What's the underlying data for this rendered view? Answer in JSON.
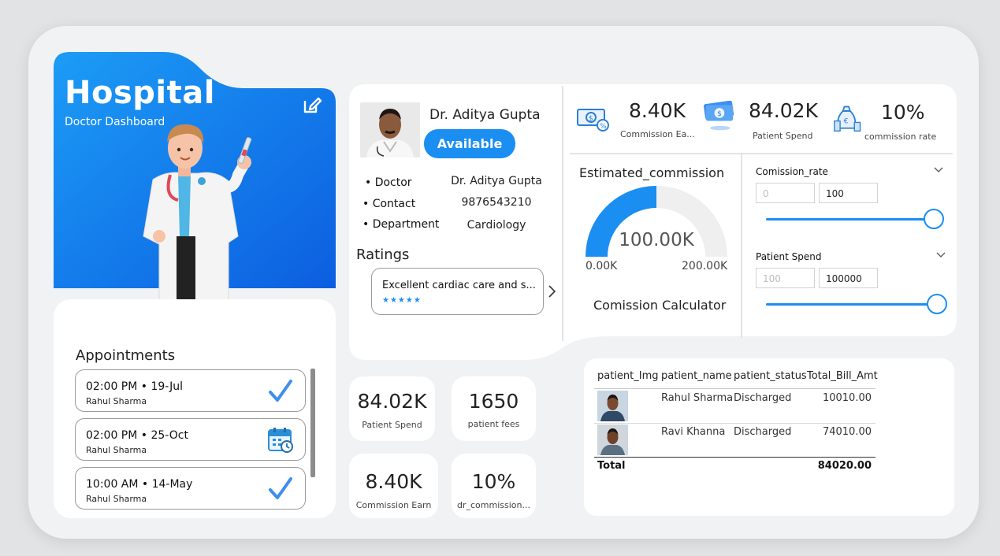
{
  "hero": {
    "title": "Hospital",
    "subtitle": "Doctor Dashboard",
    "edit_icon": "edit-icon",
    "gradient_from": "#1c9cf6",
    "gradient_to": "#0c5ee0"
  },
  "appointments": {
    "title": "Appointments",
    "items": [
      {
        "time": "02:00 PM • 19-Jul",
        "patient": "Rahul Sharma",
        "icon": "checkmark-icon"
      },
      {
        "time": "02:00 PM • 25-Oct",
        "patient": "Rahul Sharma",
        "icon": "calendar-clock-icon"
      },
      {
        "time": "10:00 AM • 14-May",
        "patient": "Rahul Sharma",
        "icon": "checkmark-icon"
      }
    ]
  },
  "doctor": {
    "name": "Dr. Aditya Gupta",
    "status_button": "Available",
    "info": [
      {
        "label": "• Doctor",
        "value": "Dr. Aditya Gupta"
      },
      {
        "label": "• Contact",
        "value": "9876543210"
      },
      {
        "label": "• Department",
        "value": "Cardiology"
      }
    ],
    "ratings_title": "Ratings",
    "review_text": "Excellent cardiac care and s...",
    "review_stars": "★★★★★"
  },
  "top_kpis": [
    {
      "value": "8.40K",
      "label": "Commission Ea...",
      "icon": "commission-money-icon"
    },
    {
      "value": "84.02K",
      "label": "Patient Spend",
      "icon": "cash-stack-icon"
    },
    {
      "value": "10%",
      "label": "commission  rate",
      "icon": "money-bags-icon"
    }
  ],
  "gauge": {
    "title": "Estimated_commission",
    "value": 100000,
    "value_label": "100.00K",
    "min": 0,
    "min_label": "0.00K",
    "max": 200000,
    "max_label": "200.00K",
    "fill_color": "#1b8ef2",
    "track_color": "#efefef",
    "footer": "Comission Calculator"
  },
  "sliders": [
    {
      "title": "Comission_rate",
      "min_placeholder": "0",
      "max_value": "100",
      "fraction": 1.0
    },
    {
      "title": "Patient Spend",
      "min_placeholder": "100",
      "max_value": "100000",
      "fraction": 1.0
    }
  ],
  "small_kpis": [
    {
      "value": "84.02K",
      "label": "Patient Spend"
    },
    {
      "value": "1650",
      "label": "patient fees"
    },
    {
      "value": "8.40K",
      "label": "Commission Earn"
    },
    {
      "value": "10%",
      "label": "dr_commission..."
    }
  ],
  "table": {
    "headers": [
      "patient_Img",
      "patient_name",
      "patient_status",
      "Total_Bill_Amt"
    ],
    "rows": [
      {
        "name": "Rahul Sharma",
        "status": "Discharged",
        "amount": "10010.00"
      },
      {
        "name": "Ravi Khanna",
        "status": "Discharged",
        "amount": "74010.00"
      }
    ],
    "total_label": "Total",
    "total_amount": "84020.00"
  }
}
